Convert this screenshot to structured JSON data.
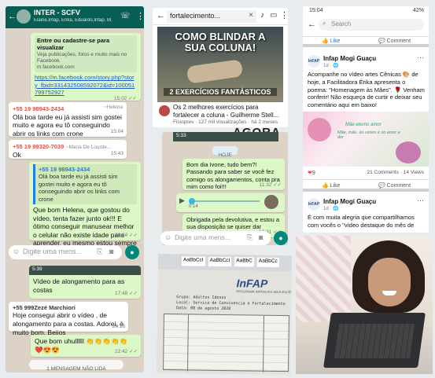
{
  "whatsapp_left": {
    "header_title": "INTER - SCFV",
    "header_sub": "Elaine,Infap, Erika, Eduardo,Infap, M...",
    "bubble1_text": "Entre ou cadastre-se para visualizar",
    "bubble1_sub": "Veja publicações, fotos e muito mais no Facebook.",
    "bubble1_domain": "m.facebook.com",
    "bubble1_link": "https://m.facebook.com/story.php?story_fbid=331432508592072&id=100051799752927",
    "bubble1_time": "15:02 ✓✓",
    "msg2_sender": "+55 19 98943-2434",
    "msg2_alias": "~Helena",
    "msg2_text": "Olá boa tarde eu já assisti sim gostei muito e agora eu tô conseguindo abrir os links com crone",
    "msg2_time": "15:04",
    "msg3_sender": "+55 19 99320-7039",
    "msg3_alias": "~Maria De Lourde...",
    "msg3_text": "Ok",
    "msg3_time": "15:43",
    "msg4_quote_name": "+55 19 98943-2434",
    "msg4_quote_text": "Olá boa tarde eu já assisti sim gostei muito e agora eu tô conseguindo abrir os links com crone",
    "msg4_text": "Que bom Helena, que gostou do vídeo, tenta fazer junto ok!!! E ótimo conseguir manusear melhor o celular não existe idade para aprender, eu mesmo estou sempre aprendendo 👍",
    "msg4_time": "16:04 ✓✓",
    "input_placeholder": "Digite uma mens...",
    "video_caption": "Vídeo de alongamento para as costas",
    "video_time": "17:48 ✓✓",
    "video_duration": "5:39",
    "msg6_sender": "+55 999Zezé Marchiori",
    "msg6_text": "Hoje consegui abrir o vídeo , de alongamento para a costas. Adorei, é muito bom. Beijos",
    "msg6_time": "20:16",
    "msg7_text": "Que bom uhullllll 👏👏👏👏👏 ❤️😍😍",
    "msg7_time": "22:42 ✓✓",
    "unread_banner": "1 MENSAGEM NÃO LIDA"
  },
  "youtube": {
    "search_text": "fortalecimento...",
    "thumb_title": "COMO BLINDAR A SUA COLUNA!",
    "thumb_banner": "2 EXERCÍCIOS FANTÁSTICOS",
    "video_title": "Os 2 melhores exercícios para fortalecer a coluna - Guilherme Stell...",
    "video_meta": "Fisioprev · 127 mil visualizações · há 2 meses",
    "overlay_text": "AGORA"
  },
  "whatsapp_mid": {
    "date_chip": "HOJE",
    "msg1_text": "Bom dia Ivone, tudo bem?! Passando para saber se você fez comigo os alongamentos, conta pra mim como foi!!!",
    "msg1_time": "11:32 ✓✓",
    "audio_duration": "0:14",
    "audio_time": "11:33 ✓✓",
    "msg2_text": "Obrigada pela devolutiva, e estou a sua disposição se quiser dar alguma sugestão.😘",
    "msg2_time": "13:31 ✓✓",
    "input_placeholder": "Digite uma mens...",
    "video_duration": "5:33"
  },
  "document": {
    "logo_text": "InFAP",
    "logo_sub": "PROGRAMA INFÂNCIA E ADOLESCÊNCIA",
    "header_cells": [
      "AaBbCcI",
      "AaBbCcI",
      "AaBbC",
      "AaBbCc"
    ],
    "line1": "Grupo: Adultos Idosos",
    "line2": "Local: Servico de Convivencia e Fortalecimento de Vinculos",
    "line3": "Data: 08 de agosto 2020"
  },
  "facebook": {
    "status_time": "15:04",
    "status_battery": "42%",
    "search_placeholder": "Search",
    "like_label": "Like",
    "comment_label": "Comment",
    "post1_author": "Infap Mogi Guaçu",
    "post1_time": "1d · 🌐",
    "post1_text": "Acompanhe no vídeo artes Cênicas 🎨 de hoje, a Facilitadora Érika apresenta o poema: \"Homenagem às Mães\". 🌹 Venham conferir! Não esqueça de curtir e deixar seu comentário aqui em baixo!",
    "poem_line1": "Mãe eterno amor",
    "poem_line2": "Mãe, mãe, às vezes é só amor e dor",
    "reactions_count": "9",
    "comments_count": "21 Comments · 14 Views",
    "post2_author": "Infap Mogi Guaçu",
    "post2_time": "1d · 🌐",
    "post2_text": "É com muita alegria que compartilhamos com vocês o \"vídeo destaque do mês de"
  }
}
